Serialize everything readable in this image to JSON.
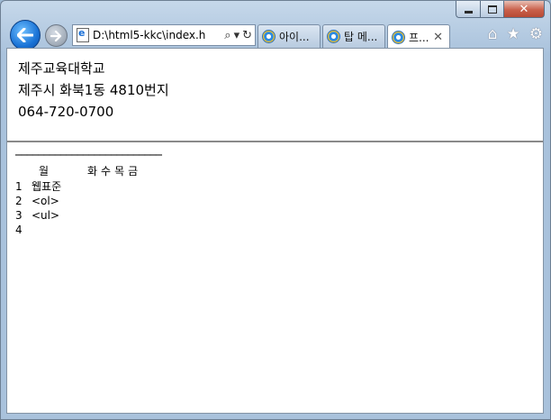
{
  "window": {
    "address": "D:\\html5-kkc\\index.h",
    "tabs": [
      {
        "label": "아이..."
      },
      {
        "label": "탑 메..."
      },
      {
        "label": "프..."
      }
    ]
  },
  "page": {
    "header_lines": [
      "제주교육대학교",
      "제주시 화북1동 4810번지",
      "064-720-0700"
    ],
    "rule": "──────────────────────────",
    "table": {
      "columns": [
        "",
        "월",
        "화",
        "수",
        "목",
        "금"
      ],
      "rows": [
        {
          "num": "1",
          "cells": [
            "웹표준",
            "",
            "",
            "",
            ""
          ]
        },
        {
          "num": "2",
          "cells": [
            "<ol>",
            "",
            "",
            "",
            ""
          ]
        },
        {
          "num": "3",
          "cells": [
            "<ul>",
            "",
            "",
            "",
            ""
          ]
        },
        {
          "num": "4",
          "cells": [
            "",
            "",
            "",
            "",
            ""
          ]
        }
      ]
    }
  },
  "icons": {
    "back": "back-arrow-icon",
    "forward": "forward-arrow-icon",
    "home": "home-icon",
    "favorites": "star-icon",
    "tools": "gear-icon"
  },
  "colors": {
    "frame": "#a9c2dc",
    "back_button": "#1a73d6",
    "close_button": "#c9604b"
  }
}
